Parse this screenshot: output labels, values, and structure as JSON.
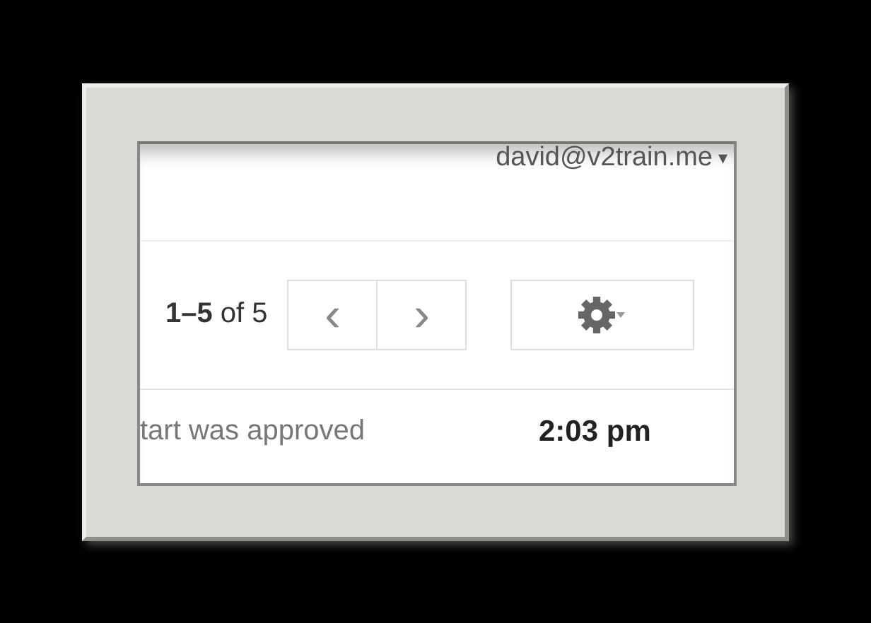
{
  "account": {
    "email": "david@v2train.me",
    "menu_caret": "▾"
  },
  "toolbar": {
    "page_range": "**1–5** of 5",
    "newer_glyph": "‹",
    "older_glyph": "›"
  },
  "message_row": {
    "snippet": "tart was approved",
    "time": "2:03 pm",
    "unread": true
  }
}
